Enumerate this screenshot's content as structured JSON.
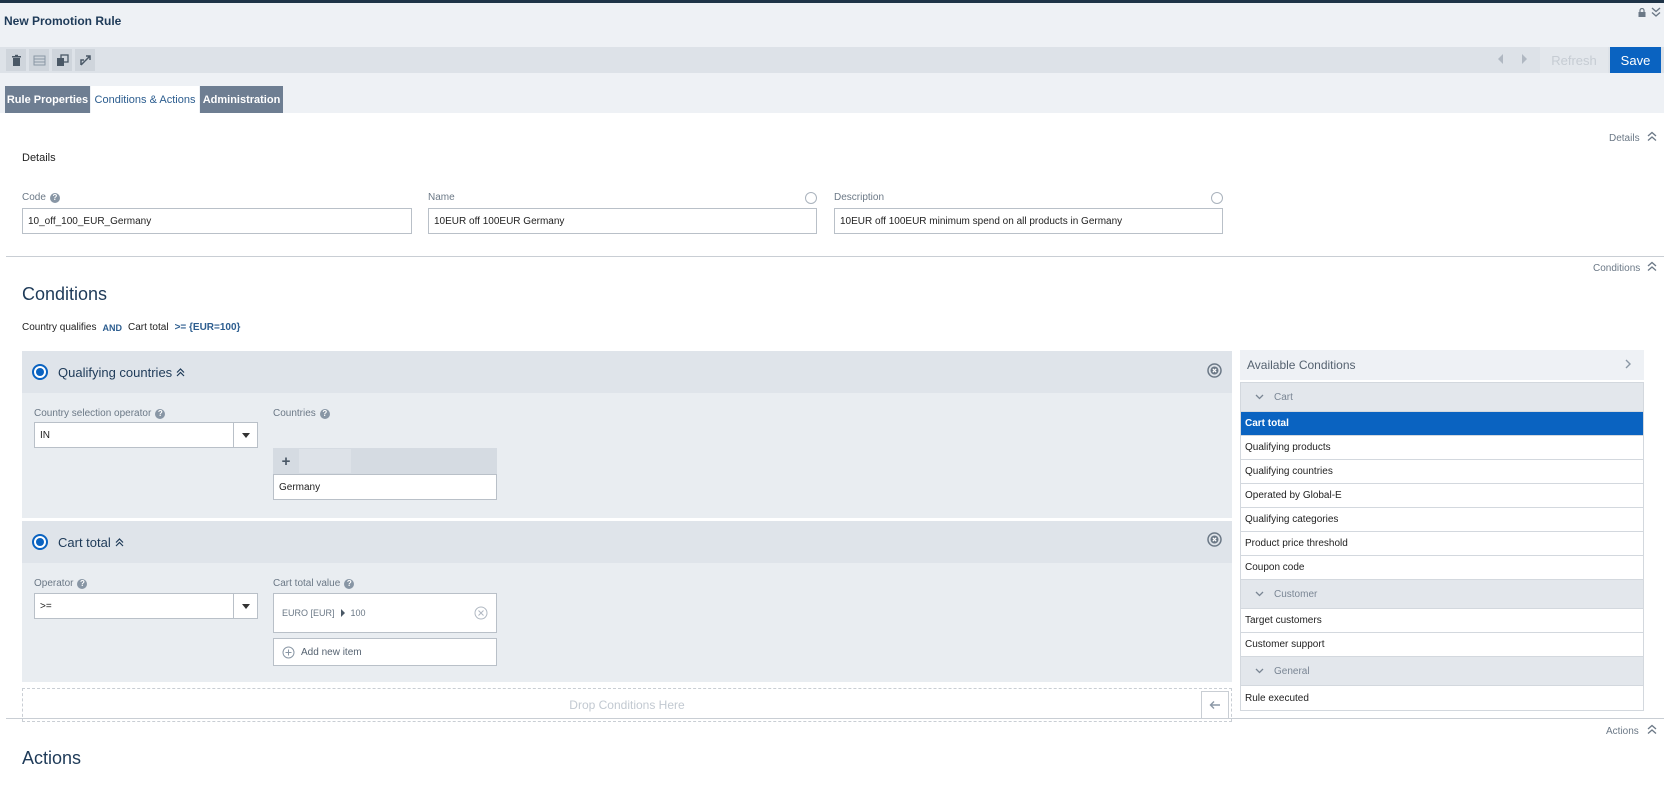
{
  "window": {
    "title": "New Promotion Rule"
  },
  "toolbar": {
    "refresh_label": "Refresh",
    "save_label": "Save"
  },
  "tabs": [
    {
      "label": "Rule Properties",
      "active": false
    },
    {
      "label": "Conditions & Actions",
      "active": true
    },
    {
      "label": "Administration",
      "active": false
    }
  ],
  "details": {
    "section_link": "Details",
    "heading": "Details",
    "code": {
      "label": "Code",
      "value": "10_off_100_EUR_Germany"
    },
    "name": {
      "label": "Name",
      "value": "10EUR off 100EUR Germany"
    },
    "description": {
      "label": "Description",
      "value": "10EUR off 100EUR minimum spend on all products in Germany"
    }
  },
  "conditions": {
    "section_link": "Conditions",
    "heading": "Conditions",
    "summary": {
      "first": "Country qualifies",
      "operator": "AND",
      "second": "Cart total",
      "expr": ">= {EUR=100}"
    },
    "qualifying_countries": {
      "title": "Qualifying countries",
      "operator_label": "Country selection operator",
      "operator_value": "IN",
      "countries_label": "Countries",
      "add_symbol": "+",
      "countries": [
        "Germany"
      ]
    },
    "cart_total": {
      "title": "Cart total",
      "operator_label": "Operator",
      "operator_value": ">=",
      "value_label": "Cart total value",
      "currency": "EURO [EUR]",
      "amount": "100",
      "add_item_label": "Add new item"
    },
    "drop_label": "Drop Conditions Here"
  },
  "available_conditions": {
    "title": "Available Conditions",
    "groups": [
      {
        "name": "Cart",
        "items": [
          "Cart total",
          "Qualifying products",
          "Qualifying countries",
          "Operated by Global-E",
          "Qualifying categories",
          "Product price threshold",
          "Coupon code"
        ]
      },
      {
        "name": "Customer",
        "items": [
          "Target customers",
          "Customer support"
        ]
      },
      {
        "name": "General",
        "items": [
          "Rule executed"
        ]
      }
    ],
    "selected": "Cart total"
  },
  "actions": {
    "section_link": "Actions",
    "heading": "Actions"
  },
  "colors": {
    "accent": "#0a63c1",
    "header_dark": "#1e3a58",
    "tab_dark": "#6e7e92"
  }
}
